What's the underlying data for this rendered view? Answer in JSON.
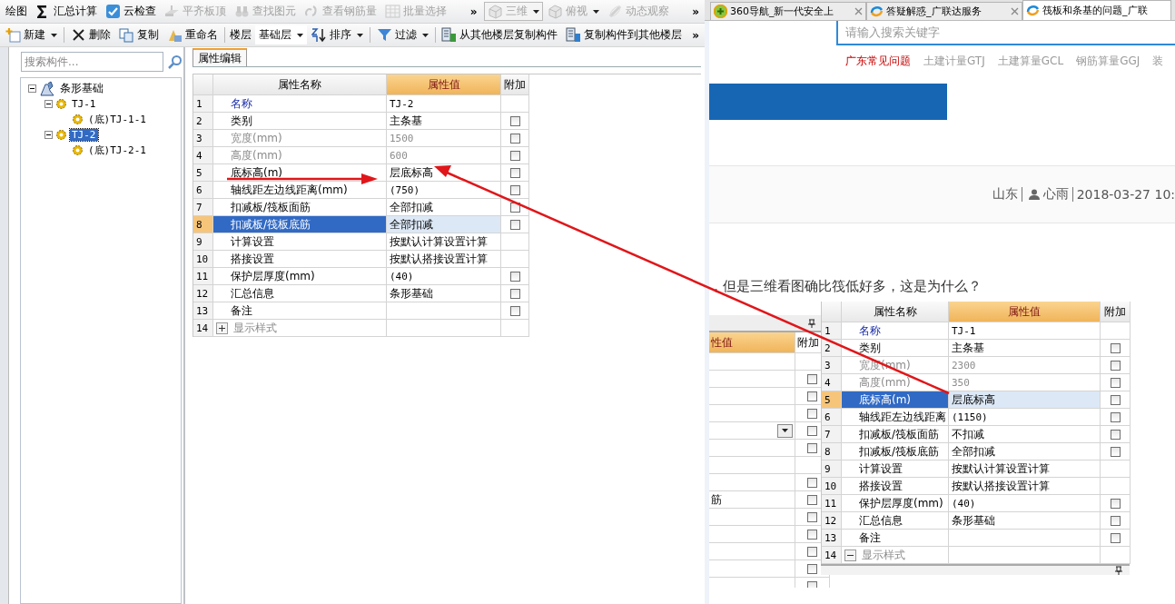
{
  "app": {
    "toolbar_top": [
      {
        "kind": "text",
        "label": "绘图",
        "disabled": false,
        "menu": false
      },
      {
        "kind": "sum",
        "label": "汇总计算",
        "disabled": false,
        "menu": false
      },
      {
        "kind": "cloud",
        "label": "云检查",
        "disabled": false,
        "menu": false
      },
      {
        "kind": "align",
        "label": "平齐板顶",
        "disabled": true,
        "menu": false
      },
      {
        "kind": "find",
        "label": "查找图元",
        "disabled": true,
        "menu": false
      },
      {
        "kind": "rebar",
        "label": "查看钢筋量",
        "disabled": true,
        "menu": false
      },
      {
        "kind": "batch",
        "label": "批量选择",
        "disabled": true,
        "menu": false
      },
      {
        "kind": "more",
        "label": "»",
        "disabled": false,
        "menu": false
      },
      {
        "kind": "cube",
        "label": "三维",
        "disabled": true,
        "menu": true
      },
      {
        "kind": "cube",
        "label": "俯视",
        "disabled": true,
        "menu": true
      },
      {
        "kind": "orbit",
        "label": "动态观察",
        "disabled": true,
        "menu": false
      },
      {
        "kind": "more",
        "label": "»",
        "disabled": false,
        "menu": false
      }
    ],
    "toolbar_bottom": [
      {
        "kind": "new",
        "label": "新建",
        "disabled": false,
        "menu": true
      },
      {
        "kind": "delete",
        "label": "删除",
        "disabled": false,
        "menu": false
      },
      {
        "kind": "copy",
        "label": "复制",
        "disabled": false,
        "menu": false
      },
      {
        "kind": "rename",
        "label": "重命名",
        "disabled": false,
        "menu": false
      },
      {
        "kind": "label",
        "label": "楼层",
        "disabled": false,
        "menu": false
      },
      {
        "kind": "select",
        "label": "基础层",
        "disabled": false,
        "menu": true
      },
      {
        "kind": "sort",
        "label": "排序",
        "disabled": false,
        "menu": true
      },
      {
        "kind": "filter",
        "label": "过滤",
        "disabled": false,
        "menu": true
      },
      {
        "kind": "copyfrom",
        "label": "从其他楼层复制构件",
        "disabled": false,
        "menu": false
      },
      {
        "kind": "copyto",
        "label": "复制构件到其他楼层",
        "disabled": false,
        "menu": false
      },
      {
        "kind": "more",
        "label": "»",
        "disabled": false,
        "menu": false
      }
    ],
    "search": {
      "placeholder": "搜索构件..."
    },
    "tree": [
      {
        "label": "条形基础",
        "kind": "group",
        "expanded": true,
        "selected": false,
        "children": [
          {
            "label": "TJ-1",
            "kind": "part",
            "expanded": true,
            "selected": false,
            "children": [
              {
                "label": "(底)TJ-1-1",
                "kind": "part",
                "selected": false
              }
            ]
          },
          {
            "label": "TJ-2",
            "kind": "part",
            "expanded": true,
            "selected": true,
            "children": [
              {
                "label": "(底)TJ-2-1",
                "kind": "part",
                "selected": false
              }
            ]
          }
        ]
      }
    ],
    "panel_tab": "属性编辑",
    "grid": {
      "columns": [
        {
          "label": "属性名称",
          "active": false
        },
        {
          "label": "属性值",
          "active": true
        },
        {
          "label": "附加",
          "active": false
        }
      ],
      "rows": [
        {
          "num": "1",
          "name": "名称",
          "value": "TJ-2",
          "kind": "link",
          "selected": false
        },
        {
          "num": "2",
          "name": "类别",
          "value": "主条基",
          "kind": "normal",
          "selected": false,
          "checked": false
        },
        {
          "num": "3",
          "name": "宽度(mm)",
          "value": "1500",
          "kind": "disabled",
          "selected": false,
          "checked": false
        },
        {
          "num": "4",
          "name": "高度(mm)",
          "value": "600",
          "kind": "disabled",
          "selected": false,
          "checked": false
        },
        {
          "num": "5",
          "name": "底标高(m)",
          "value": "层底标高",
          "kind": "normal",
          "selected": false,
          "checked": false
        },
        {
          "num": "6",
          "name": "轴线距左边线距离(mm)",
          "value": "(750)",
          "kind": "normal",
          "selected": false,
          "checked": false
        },
        {
          "num": "7",
          "name": "扣减板/筏板面筋",
          "value": "全部扣减",
          "kind": "normal",
          "selected": false,
          "checked": false
        },
        {
          "num": "8",
          "name": "扣减板/筏板底筋",
          "value": "全部扣减",
          "kind": "normal",
          "selected": true,
          "checked": false
        },
        {
          "num": "9",
          "name": "计算设置",
          "value": "按默认计算设置计算",
          "kind": "normal",
          "selected": false
        },
        {
          "num": "10",
          "name": "搭接设置",
          "value": "按默认搭接设置计算",
          "kind": "normal",
          "selected": false
        },
        {
          "num": "11",
          "name": "保护层厚度(mm)",
          "value": "(40)",
          "kind": "normal",
          "selected": false,
          "checked": false
        },
        {
          "num": "12",
          "name": "汇总信息",
          "value": "条形基础",
          "kind": "normal",
          "selected": false,
          "checked": false
        },
        {
          "num": "13",
          "name": "备注",
          "value": "",
          "kind": "normal",
          "selected": false,
          "checked": false
        },
        {
          "num": "14",
          "name": "显示样式",
          "kind": "group",
          "expanded": false,
          "selected": false
        }
      ]
    }
  },
  "browser": {
    "tabs": [
      {
        "label": "360导航_新一代安全上",
        "selected": false,
        "closable": true
      },
      {
        "label": "答疑解惑_广联达服务",
        "selected": false,
        "closable": true
      },
      {
        "label": "筏板和条基的问题_广联",
        "selected": true,
        "closable": false
      }
    ],
    "search": {
      "placeholder": "请输入搜索关键字"
    },
    "nav": [
      {
        "label": "广东常见问题",
        "selected": true
      },
      {
        "label": "土建计量GTJ",
        "selected": false
      },
      {
        "label": "土建算量GCL",
        "selected": false
      },
      {
        "label": "钢筋算量GGJ",
        "selected": false
      },
      {
        "label": "装",
        "selected": false
      }
    ],
    "meta": {
      "region": "山东",
      "author": "心雨",
      "time": "2018-03-27 10:"
    },
    "question": "，但是三维看图确比筏低好多，这是为什么？",
    "back_snippet": {
      "columns": [
        {
          "label": "性值",
          "active": true
        },
        {
          "label": "附加",
          "active": false
        }
      ],
      "rows": [
        {
          "kind": "plain"
        },
        {
          "kind": "plain",
          "checked": false
        },
        {
          "kind": "plain",
          "checked": false
        },
        {
          "kind": "plain",
          "checked": false
        },
        {
          "kind": "dropdown",
          "checked": false
        },
        {
          "kind": "plain",
          "checked": false
        },
        {
          "kind": "plain"
        },
        {
          "kind": "plain",
          "checked": false
        },
        {
          "kind": "plain",
          "value": "筋",
          "checked": false
        },
        {
          "kind": "plain",
          "checked": false
        },
        {
          "kind": "plain",
          "checked": false
        },
        {
          "kind": "plain",
          "checked": false
        },
        {
          "kind": "plain",
          "checked": false
        },
        {
          "kind": "plain",
          "checked": false
        }
      ]
    },
    "front_snippet": {
      "columns": [
        {
          "label": "属性名称",
          "active": false
        },
        {
          "label": "属性值",
          "active": true
        },
        {
          "label": "附加",
          "active": false
        }
      ],
      "rows": [
        {
          "num": "1",
          "name": "名称",
          "value": "TJ-1",
          "kind": "link",
          "selected": false
        },
        {
          "num": "2",
          "name": "类别",
          "value": "主条基",
          "kind": "normal",
          "selected": false,
          "checked": false
        },
        {
          "num": "3",
          "name": "宽度(mm)",
          "value": "2300",
          "kind": "disabled",
          "selected": false,
          "checked": false
        },
        {
          "num": "4",
          "name": "高度(mm)",
          "value": "350",
          "kind": "disabled",
          "selected": false,
          "checked": false
        },
        {
          "num": "5",
          "name": "底标高(m)",
          "value": "层底标高",
          "kind": "normal",
          "selected": true,
          "checked": false
        },
        {
          "num": "6",
          "name": "轴线距左边线距离",
          "value": "(1150)",
          "kind": "normal",
          "selected": false,
          "checked": false
        },
        {
          "num": "7",
          "name": "扣减板/筏板面筋",
          "value": "不扣减",
          "kind": "normal",
          "selected": false,
          "checked": false
        },
        {
          "num": "8",
          "name": "扣减板/筏板底筋",
          "value": "全部扣减",
          "kind": "normal",
          "selected": false,
          "checked": false
        },
        {
          "num": "9",
          "name": "计算设置",
          "value": "按默认计算设置计算",
          "kind": "normal",
          "selected": false
        },
        {
          "num": "10",
          "name": "搭接设置",
          "value": "按默认搭接设置计算",
          "kind": "normal",
          "selected": false
        },
        {
          "num": "11",
          "name": "保护层厚度(mm)",
          "value": "(40)",
          "kind": "normal",
          "selected": false,
          "checked": false
        },
        {
          "num": "12",
          "name": "汇总信息",
          "value": "条形基础",
          "kind": "normal",
          "selected": false,
          "checked": false
        },
        {
          "num": "13",
          "name": "备注",
          "value": "",
          "kind": "normal",
          "selected": false,
          "checked": false
        },
        {
          "num": "14",
          "name": "显示样式",
          "kind": "group",
          "expanded": true,
          "selected": false
        }
      ]
    }
  }
}
